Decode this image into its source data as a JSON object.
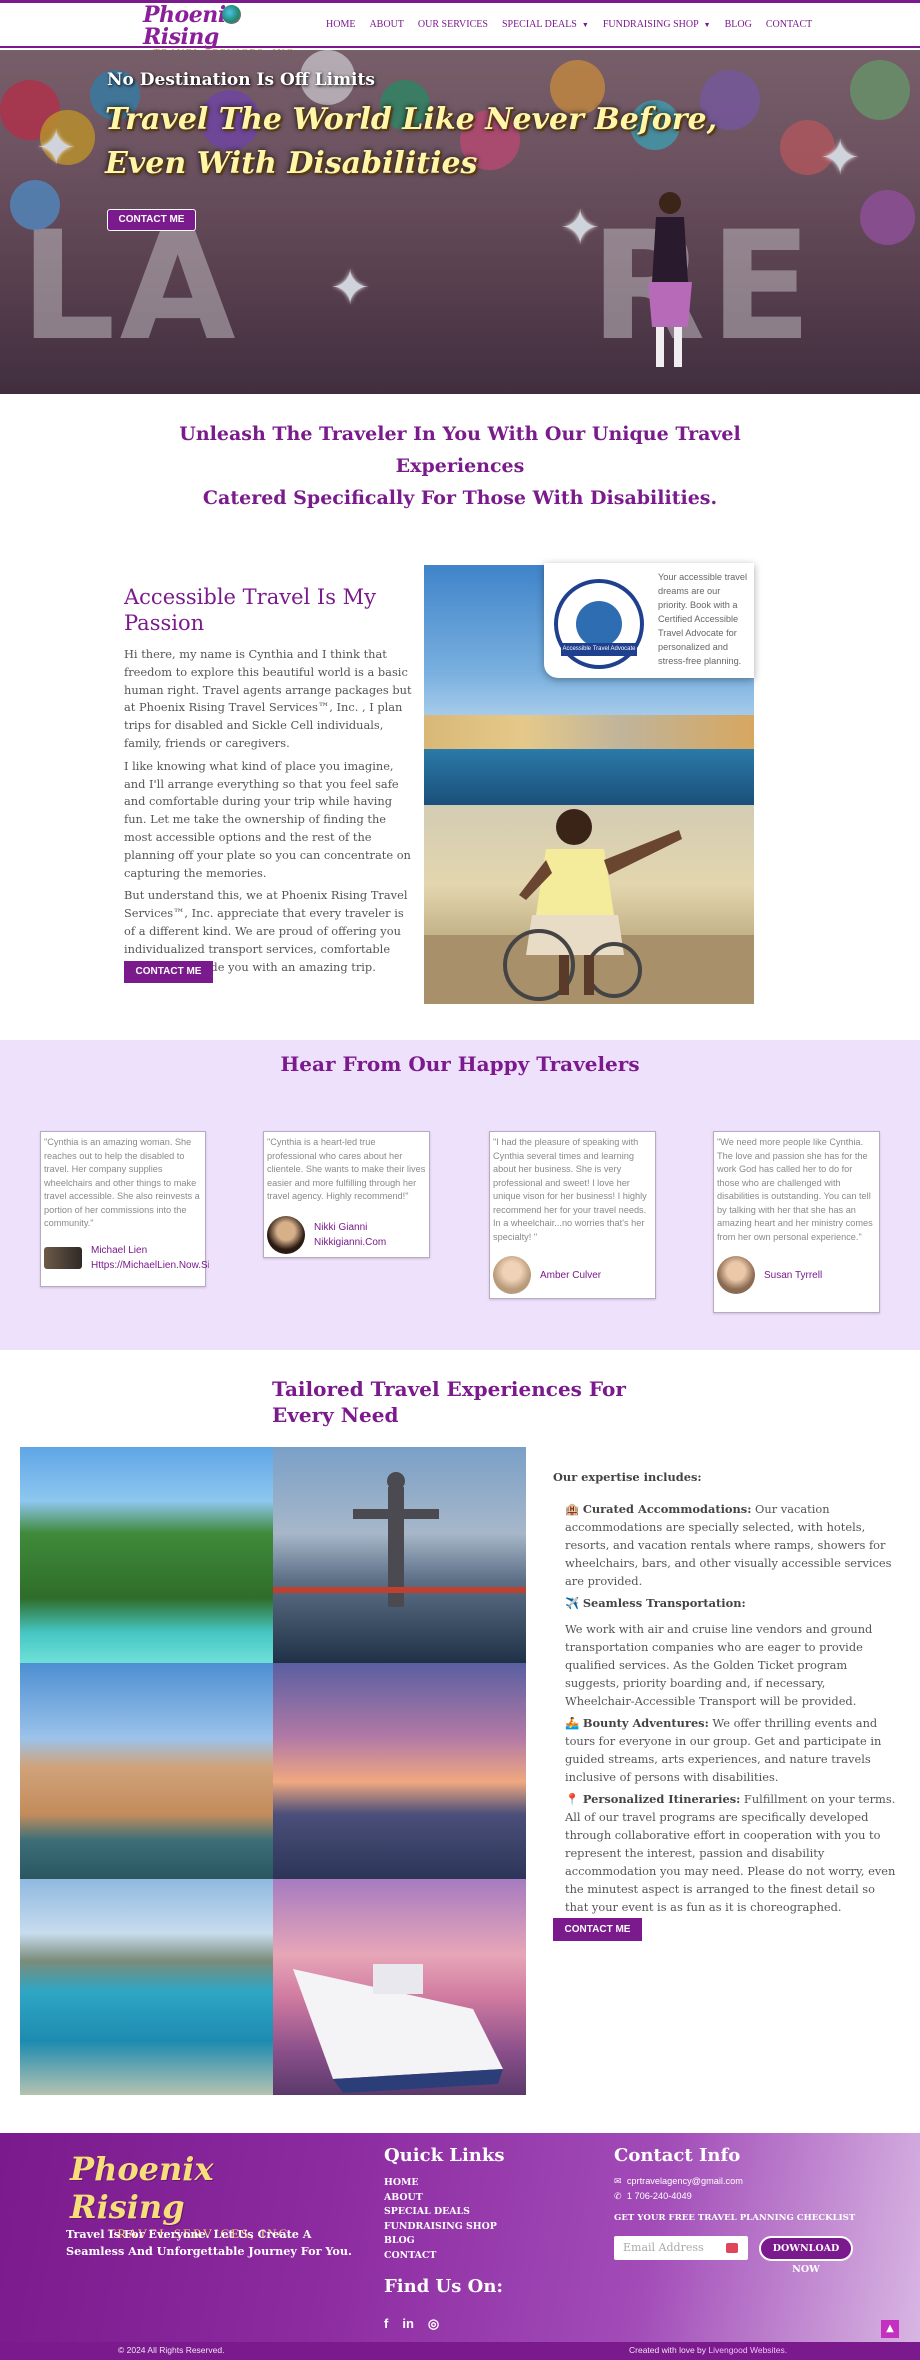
{
  "brand": {
    "logo_main": "Phoenix Rising",
    "logo_sub": "TRAVEL SERVICES, INC.",
    "accent": "#7a1a8c",
    "gold": "#f6df7a"
  },
  "nav": {
    "items": [
      "HOME",
      "ABOUT",
      "OUR SERVICES",
      "SPECIAL DEALS",
      "FUNDRAISING SHOP",
      "BLOG",
      "CONTACT"
    ]
  },
  "hero": {
    "tagline": "No Destination Is Off Limits",
    "title_line1": "Travel The World Like Never Before,",
    "title_line2": "Even With Disabilities",
    "button": "CONTACT ME"
  },
  "headline": {
    "line1": "Unleash The Traveler In You With Our Unique Travel Experiences",
    "line2": "Catered  Specifically For Those With Disabilities."
  },
  "passion": {
    "title": "Accessible Travel Is My Passion",
    "p1": "Hi there, my name is Cynthia and I think that freedom to explore this beautiful world is a basic human right. Travel agents arrange packages but at Phoenix Rising Travel Services™, Inc. , I plan trips for disabled and Sickle Cell individuals, family, friends or caregivers.",
    "p2": "I like knowing what kind of place you imagine, and I'll arrange everything so that you feel safe and comfortable during your trip while having fun. Let me take the ownership of finding the most accessible options and the rest of the planning off your plate so you can concentrate on capturing the memories.",
    "p3": "But understand this, we at Phoenix Rising Travel Services™, Inc. appreciate that every traveler is of a different kind. We are proud of offering you individualized transport services, comfortable cars, and provide you with an amazing trip.",
    "button": "CONTACT ME",
    "badge_text": "Your accessible travel dreams are our priority. Book with a Certified Accessible Travel Advocate for personalized and stress-free planning.",
    "badge_ribbon": "Accessible Travel Advocate"
  },
  "testimonials": {
    "title": "Hear From Our Happy Travelers",
    "items": [
      {
        "quote": "\"Cynthia is an amazing woman. She reaches out to help the disabled to travel. Her company supplies wheelchairs and other things to make travel accessible. She also reinvests a portion of her commissions into the community.\"",
        "name": "Michael Lien",
        "sub": "Https://MichaelLien.Now.Site"
      },
      {
        "quote": "\"Cynthia is a heart-led true professional who cares about her clientele. She wants to make their lives easier and more fulfilling through her travel agency. Highly recommend!\"",
        "name": "Nikki Gianni",
        "sub": "Nikkigianni.Com"
      },
      {
        "quote": "\"I had the pleasure of speaking with Cynthia several times and learning about her business. She is very professional and sweet! I love her unique vison for her business! I highly recommend her for your travel needs. In a wheelchair...no worries that's her specialty! \"",
        "name": "Amber Culver",
        "sub": ""
      },
      {
        "quote": "\"We need more people like Cynthia. The love and passion she has for the work God has called her to do for those who are challenged with disabilities is outstanding. You can tell by talking with her that she has an amazing heart and her ministry comes from her own personal experience.\"",
        "name": "Susan Tyrrell",
        "sub": ""
      }
    ]
  },
  "tailored": {
    "title": "Tailored Travel Experiences For Every Need",
    "lead": "Our expertise includes:",
    "items": [
      {
        "icon": "🏨",
        "heading": "Curated Accommodations:",
        "text": " Our vacation accommodations are specially selected, with hotels, resorts, and vacation rentals where ramps, showers for wheelchairs, bars, and other visually accessible services are provided."
      },
      {
        "icon": "✈️",
        "heading": "Seamless Transportation:",
        "text": ""
      },
      {
        "icon": "",
        "heading": "",
        "text": "We work with air and cruise line vendors and ground transportation companies who are eager to provide qualified services. As the Golden Ticket program suggests, priority boarding and, if necessary, Wheelchair-Accessible Transport will be provided."
      },
      {
        "icon": "🚣",
        "heading": "Bounty Adventures:",
        "text": " We offer thrilling events and tours for everyone in our group. Get and participate in guided streams, arts experiences, and nature travels inclusive of persons with disabilities."
      },
      {
        "icon": "📍",
        "heading": "Personalized Itineraries:",
        "text": " Fulfillment on your terms. All of our travel programs are specifically developed through collaborative effort in cooperation with you to represent the interest, passion and disability accommodation you may need. Please do not worry, even the minutest aspect is arranged to the finest detail so that your event is as fun as it is choreographed."
      }
    ],
    "button": "CONTACT ME"
  },
  "footer": {
    "tagline": "Travel Is For Everyone. Let Us Create A Seamless And Unforgettable Journey For You.",
    "quick_links_title": "Quick Links",
    "links": [
      "HOME",
      "ABOUT",
      "SPECIAL DEALS",
      "FUNDRAISING SHOP",
      "BLOG",
      "CONTACT"
    ],
    "find_us_title": "Find Us On:",
    "contact_title": "Contact Info",
    "email": "cprtravelagency@gmail.com",
    "phone": "1 706-240-4049",
    "checklist": "GET YOUR FREE TRAVEL PLANNING CHECKLIST",
    "email_placeholder": "Email Address",
    "download": "DOWNLOAD NOW",
    "copyright": "© 2024 All Rights Reserved.",
    "credit_prefix": "Created with love by ",
    "credit_link": "Livengood Websites."
  }
}
